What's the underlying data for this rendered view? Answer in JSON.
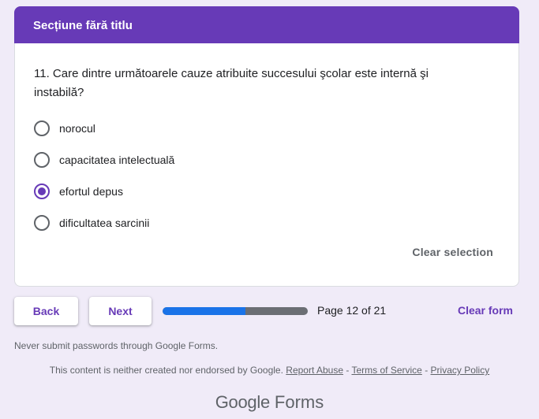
{
  "section": {
    "title": "Secțiune fără titlu"
  },
  "question": {
    "text": "11. Care dintre următoarele cauze atribuite succesului şcolar este internă şi instabilă?",
    "options": [
      {
        "label": "norocul",
        "selected": false
      },
      {
        "label": "capacitatea intelectuală",
        "selected": false
      },
      {
        "label": "efortul depus",
        "selected": true
      },
      {
        "label": "dificultatea sarcinii",
        "selected": false
      }
    ],
    "clear_selection_label": "Clear selection"
  },
  "navigation": {
    "back_label": "Back",
    "next_label": "Next",
    "page_label": "Page 12 of 21",
    "progress_fraction": 0.57,
    "clear_form_label": "Clear form"
  },
  "footer": {
    "password_warning": "Never submit passwords through Google Forms.",
    "disclaimer_text": "This content is neither created nor endorsed by Google.",
    "report_abuse": "Report Abuse",
    "terms_of_service": "Terms of Service",
    "privacy_policy": "Privacy Policy",
    "separator": "-",
    "logo_brand": "Google",
    "logo_product": "Forms"
  },
  "colors": {
    "accent": "#673ab7",
    "background": "#f0ebf8",
    "progress_fill": "#1a73e8",
    "progress_track": "#6b6e74"
  }
}
